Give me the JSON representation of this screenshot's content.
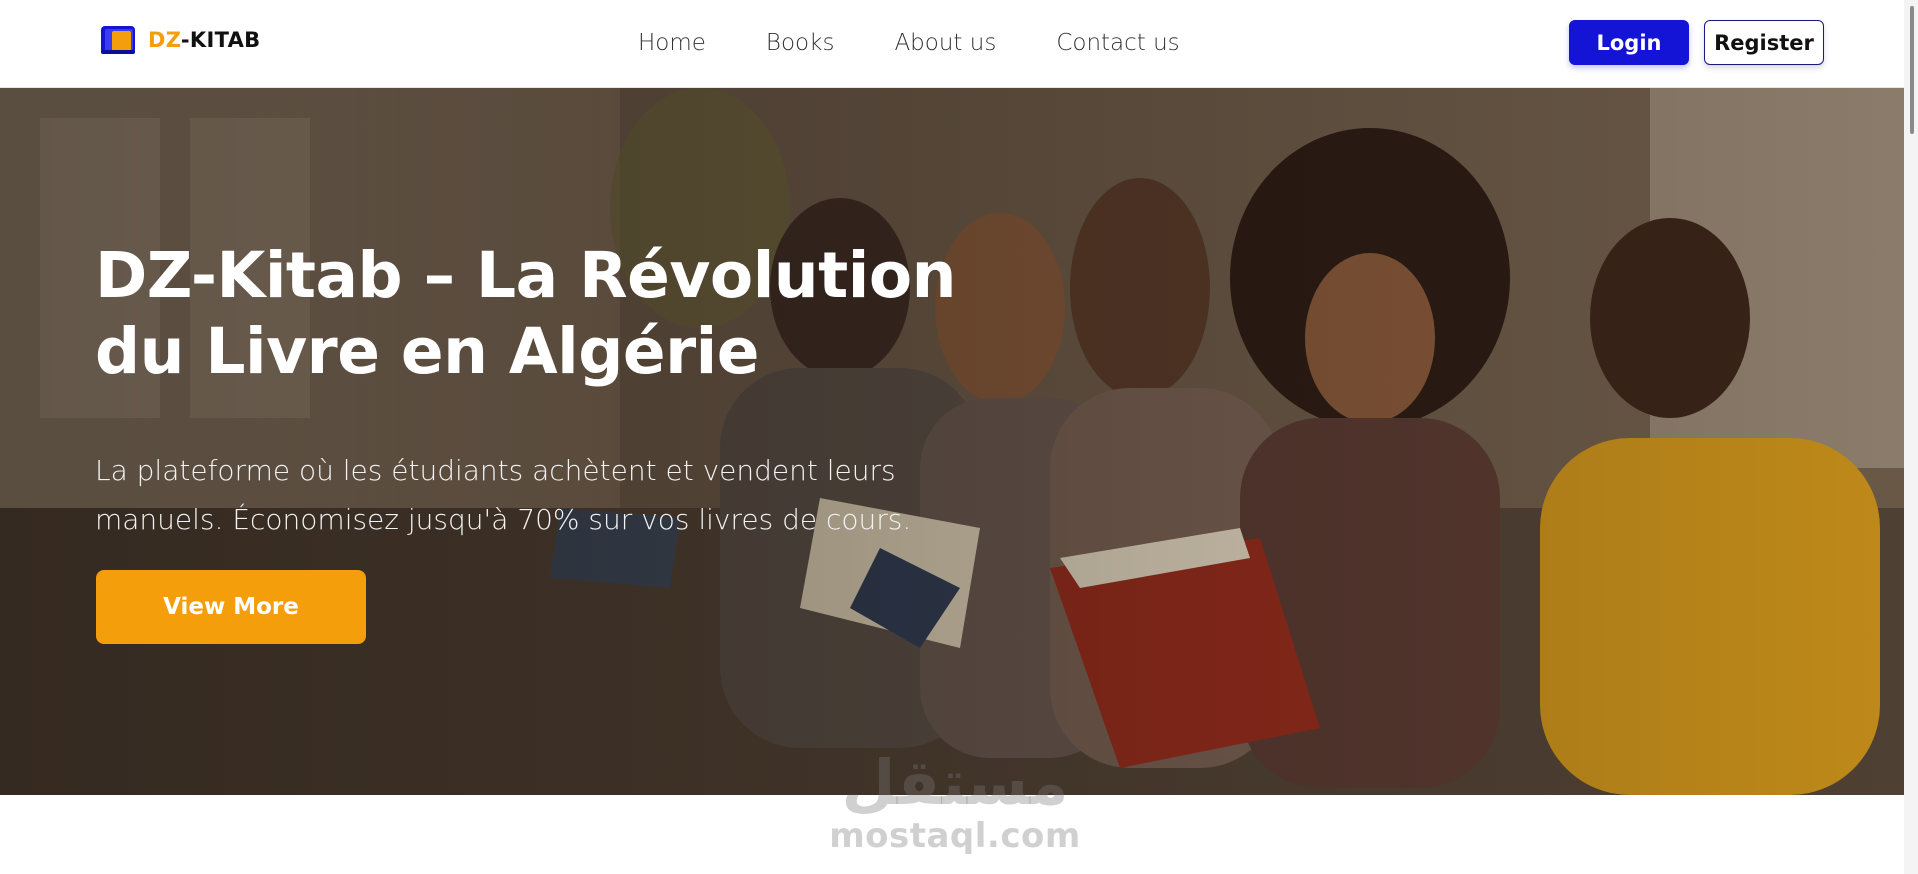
{
  "header": {
    "logo": {
      "prefix": "DZ",
      "suffix": "-KITAB",
      "icon": "book-icon"
    },
    "nav": [
      {
        "label": "Home"
      },
      {
        "label": "Books"
      },
      {
        "label": "About us"
      },
      {
        "label": "Contact us"
      }
    ],
    "login_label": "Login",
    "register_label": "Register"
  },
  "hero": {
    "title": "DZ-Kitab – La Révolution du Livre en Algérie",
    "subtitle": "La plateforme où les étudiants achètent et vendent leurs manuels. Économisez jusqu'à 70% sur vos livres de cours.",
    "cta_label": "View More",
    "image": "students-reading-photo"
  },
  "watermark": {
    "arabic": "مستقل",
    "latin": "mostaql.com"
  },
  "colors": {
    "accent": "#f59e0b",
    "primary": "#1414d6",
    "text": "#333333"
  }
}
